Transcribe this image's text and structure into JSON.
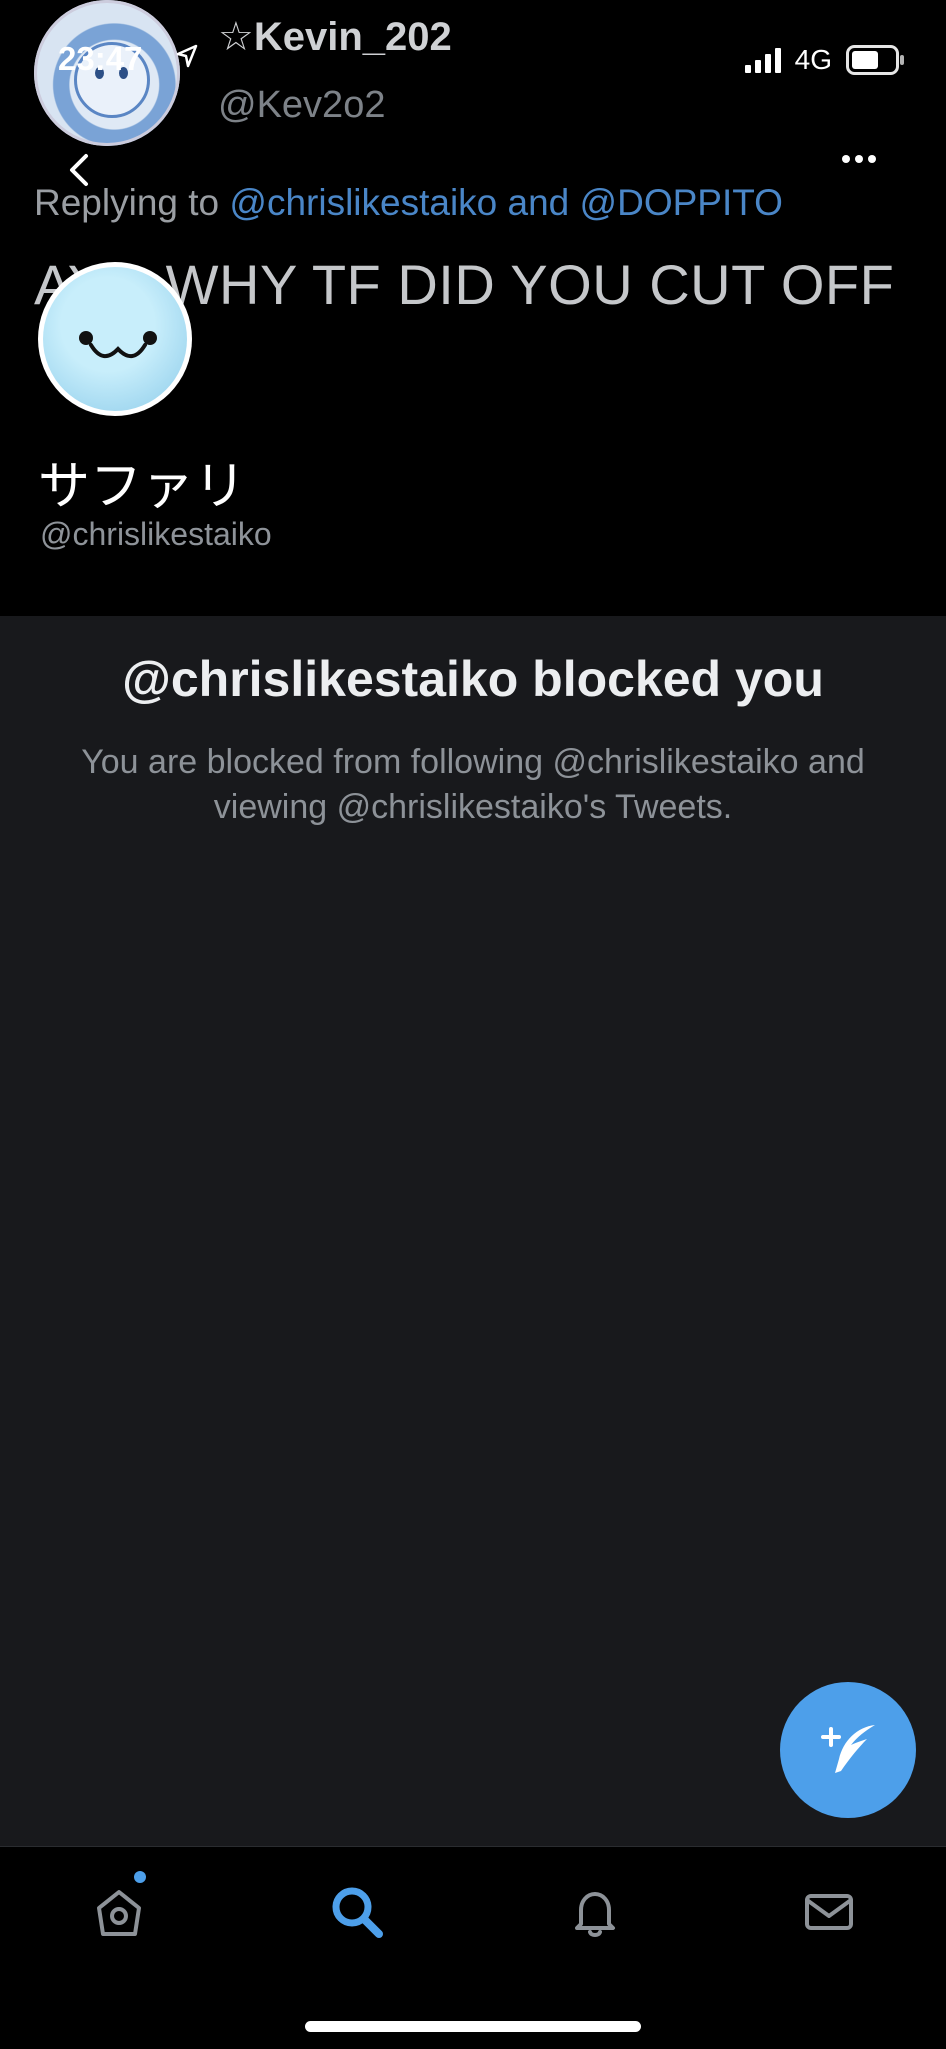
{
  "status_bar": {
    "time": "23:47",
    "network": "4G"
  },
  "banner": {
    "author_name": "☆Kevin_202",
    "author_handle": "@Kev2o2",
    "reply_prefix": "Replying to",
    "reply_mentions": "@chrislikestaiko and @DOPPITO",
    "tweet_text": "AYO WHY TF DID YOU CUT OFF"
  },
  "profile": {
    "display_name": "サファリ",
    "handle": "@chrislikestaiko"
  },
  "blocked": {
    "title": "@chrislikestaiko blocked you",
    "message": "You are blocked from following @chrislikestaiko and viewing @chrislikestaiko's Tweets."
  },
  "icons": {
    "back": "chevron-left-icon",
    "more": "more-horizontal-icon",
    "compose": "feather-plus-icon",
    "tabs": [
      "home-icon",
      "search-icon",
      "bell-icon",
      "mail-icon"
    ]
  },
  "colors": {
    "accent": "#4d9fea",
    "background": "#18191c"
  },
  "tabbar": {
    "active": "search",
    "home_has_new": true
  }
}
